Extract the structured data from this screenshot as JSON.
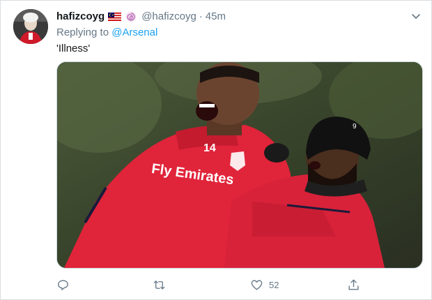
{
  "tweet": {
    "display_name": "hafizcoyg",
    "handle": "@hafizcoyg",
    "separator": "·",
    "time": "45m",
    "replying_prefix": "Replying to",
    "replying_to": "@Arsenal",
    "text": "'Illness'",
    "icons": {
      "flag": "malaysia-flag-icon",
      "badge": "swirl-badge-icon",
      "caret": "chevron-down-icon"
    },
    "media": {
      "jersey_number_left": "14",
      "jersey_sponsor": "Fly Emirates",
      "hat_logo_number": "9"
    },
    "actions": {
      "reply": {
        "icon": "reply-icon",
        "count": ""
      },
      "retweet": {
        "icon": "retweet-icon",
        "count": ""
      },
      "like": {
        "icon": "heart-icon",
        "count": "52"
      },
      "share": {
        "icon": "share-icon",
        "count": ""
      }
    },
    "colors": {
      "link": "#1da1f2",
      "muted": "#657786",
      "kit_red": "#e0243a"
    }
  }
}
